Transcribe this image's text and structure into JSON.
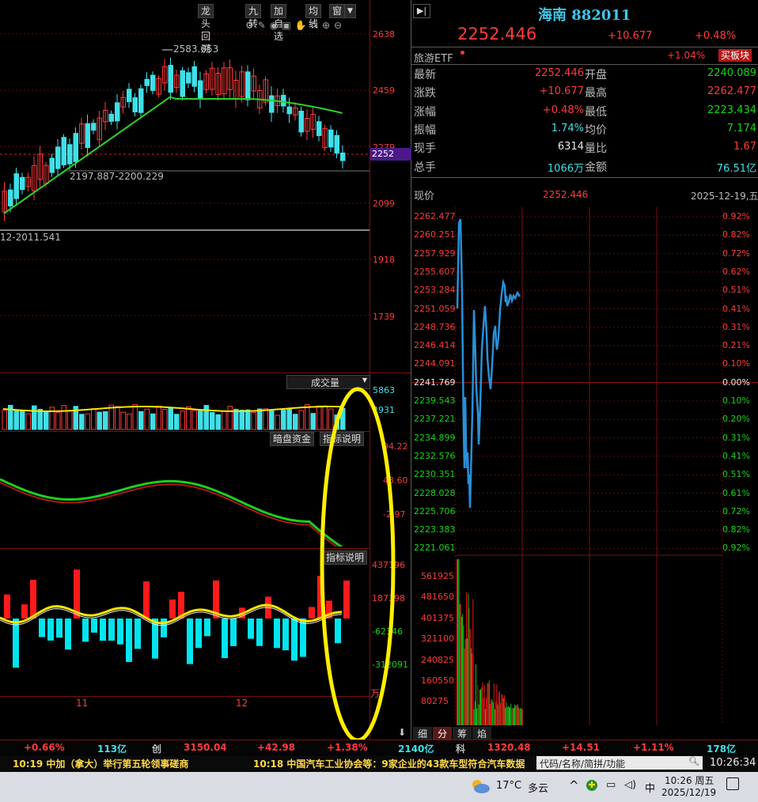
{
  "toolbar": {
    "buttons": [
      "龙头回溯",
      "九转",
      "加自选",
      "均线",
      "窗"
    ],
    "dropdown_icon": "chevron-down-icon",
    "tool_icons": [
      "settings-icon",
      "pen-icon",
      "eye-icon",
      "camera-icon",
      "hand-icon",
      "lock-icon",
      "zoom-in-icon",
      "zoom-out-icon"
    ]
  },
  "kline": {
    "annotations": {
      "high": "2583.653",
      "range": "2197.887-2200.229",
      "low_marker": "12-2011.541"
    },
    "price_axis": [
      "2638",
      "2459",
      "2279",
      "2099",
      "1918",
      "1739"
    ],
    "current_price_tag": "2252",
    "x_labels": [
      "11",
      "12"
    ]
  },
  "volume_panel": {
    "selector_label": "成交量",
    "axis": [
      "5863",
      "2931"
    ],
    "buttons": [
      "暗盘资金",
      "指标说明"
    ]
  },
  "indicator_panel": {
    "axis": [
      "94.22",
      "48.60",
      "-2.97"
    ],
    "button": "指标说明"
  },
  "money_panel": {
    "axis": [
      "437196",
      "187398",
      "-62346",
      "-312091"
    ],
    "unit": "万"
  },
  "right_panel": {
    "nav_icon": "arrow-left-bar-icon",
    "title": "海南 882011",
    "price": "2252.446",
    "change": "+10.677",
    "change_pct": "+0.48%",
    "related": {
      "name": "旅游ETF",
      "pct": "+1.04%",
      "button": "买板块"
    },
    "stats": [
      {
        "l1": "最新",
        "v1": "2252.446",
        "c1": "red",
        "l2": "开盘",
        "v2": "2240.089",
        "c2": "green"
      },
      {
        "l1": "涨跌",
        "v1": "+10.677",
        "c1": "red",
        "l2": "最高",
        "v2": "2262.477",
        "c2": "red"
      },
      {
        "l1": "涨幅",
        "v1": "+0.48%",
        "c1": "red",
        "l2": "最低",
        "v2": "2223.434",
        "c2": "green"
      },
      {
        "l1": "振幅",
        "v1": "1.74%",
        "c1": "cyan",
        "l2": "均价",
        "v2": "7.174",
        "c2": "green"
      },
      {
        "l1": "现手",
        "v1": "6314",
        "c1": "white",
        "l2": "量比",
        "v2": "1.67",
        "c2": "red"
      },
      {
        "l1": "总手",
        "v1": "1066万",
        "c1": "cyan",
        "l2": "金额",
        "v2": "76.51亿",
        "c2": "cyan"
      }
    ],
    "intraday_header": {
      "label": "现价",
      "price": "2252.446",
      "date": "2025-12-19,五"
    },
    "price_ticks": [
      "2262.477",
      "2260.251",
      "2257.929",
      "2255.607",
      "2253.284",
      "2251.059",
      "2248.736",
      "2246.414",
      "2244.091",
      "2241.769",
      "2239.543",
      "2237.221",
      "2234.899",
      "2232.576",
      "2230.351",
      "2228.028",
      "2225.706",
      "2223.383",
      "2221.061"
    ],
    "pct_ticks": [
      "0.92%",
      "0.82%",
      "0.72%",
      "0.62%",
      "0.51%",
      "0.41%",
      "0.31%",
      "0.21%",
      "0.10%",
      "0.00%",
      "0.10%",
      "0.20%",
      "0.31%",
      "0.41%",
      "0.51%",
      "0.61%",
      "0.72%",
      "0.82%",
      "0.92%"
    ],
    "vol_ticks": [
      "561925",
      "481650",
      "401375",
      "321100",
      "240825",
      "160550",
      "80275"
    ],
    "tabs": [
      "细",
      "分",
      "筹",
      "焰"
    ],
    "download_icon": "download-icon"
  },
  "status_bar": {
    "items": [
      {
        "t": "+0.66%",
        "c": "red"
      },
      {
        "t": "113亿",
        "c": "cyan"
      },
      {
        "t": "创",
        "c": "gray"
      },
      {
        "t": "3150.04",
        "c": "red"
      },
      {
        "t": "+42.98",
        "c": "red"
      },
      {
        "t": "+1.38%",
        "c": "red"
      },
      {
        "t": "2140亿",
        "c": "cyan"
      },
      {
        "t": "科",
        "c": "gray"
      },
      {
        "t": "1320.48",
        "c": "red"
      },
      {
        "t": "+14.51",
        "c": "red"
      },
      {
        "t": "+1.11%",
        "c": "red"
      },
      {
        "t": "178亿",
        "c": "cyan"
      }
    ]
  },
  "news_bar": {
    "items": [
      "10:19 中加（拿大）举行第五轮领事磋商",
      "10:18 中国汽车工业协会等：9家企业的43款车型符合汽车数据"
    ],
    "search_placeholder": "代码/名称/简拼/功能",
    "clock": "10:26:34"
  },
  "taskbar": {
    "weather_icon": "weather-cloud-icon",
    "temp": "17°C",
    "weather": "多云",
    "tray_icons": [
      "chevron-up-icon",
      "app-tray-icon",
      "network-icon",
      "volume-icon"
    ],
    "ime": "中",
    "time": "10:26 周五",
    "date": "2025/12/19",
    "notification_icon": "notification-icon"
  },
  "colors": {
    "up": "#ff3b3b",
    "down": "#18d418",
    "teal": "#3ee0e8",
    "yellow": "#ffe600",
    "grid": "#7a0f0f",
    "intraday": "#2a8fd6"
  }
}
